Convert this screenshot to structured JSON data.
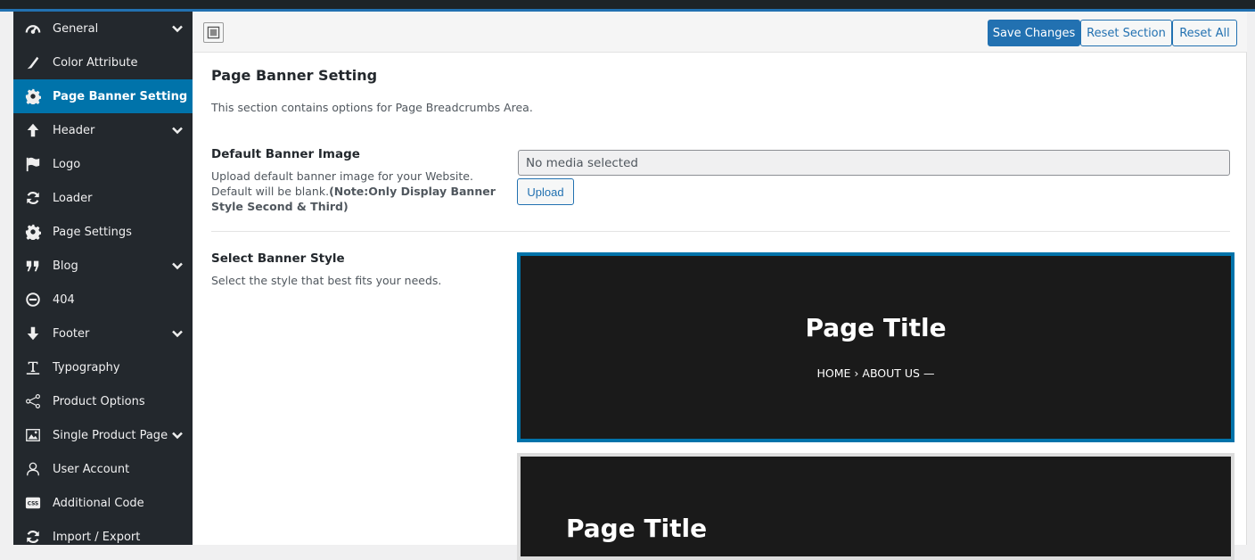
{
  "sidebar": {
    "items": [
      {
        "label": "General",
        "icon": "dashboard-icon",
        "expandable": true
      },
      {
        "label": "Color Attribute",
        "icon": "brush-icon",
        "expandable": false
      },
      {
        "label": "Page Banner Setting",
        "icon": "gear-icon",
        "expandable": false,
        "active": true
      },
      {
        "label": "Header",
        "icon": "arrow-up-icon",
        "expandable": true
      },
      {
        "label": "Logo",
        "icon": "flag-icon",
        "expandable": false
      },
      {
        "label": "Loader",
        "icon": "refresh-icon",
        "expandable": false
      },
      {
        "label": "Page Settings",
        "icon": "gear-icon",
        "expandable": false
      },
      {
        "label": "Blog",
        "icon": "quote-icon",
        "expandable": true
      },
      {
        "label": "404",
        "icon": "minus-circle-icon",
        "expandable": false
      },
      {
        "label": "Footer",
        "icon": "arrow-down-icon",
        "expandable": true
      },
      {
        "label": "Typography",
        "icon": "text-icon",
        "expandable": false
      },
      {
        "label": "Product Options",
        "icon": "share-icon",
        "expandable": false
      },
      {
        "label": "Single Product Page",
        "icon": "image-icon",
        "expandable": true
      },
      {
        "label": "User Account",
        "icon": "user-icon",
        "expandable": false
      },
      {
        "label": "Additional Code",
        "icon": "css-icon",
        "expandable": false
      },
      {
        "label": "Import / Export",
        "icon": "refresh-icon",
        "expandable": false
      }
    ]
  },
  "toolbar": {
    "save_label": "Save Changes",
    "reset_section_label": "Reset Section",
    "reset_all_label": "Reset All"
  },
  "section": {
    "title": "Page Banner Setting",
    "description": "This section contains options for Page Breadcrumbs Area."
  },
  "banner_image": {
    "title": "Default Banner Image",
    "description": "Upload default banner image for your Website. Default will be blank.",
    "note": "(Note:Only Display Banner Style Second & Third)",
    "value": "No media selected",
    "upload_label": "Upload"
  },
  "banner_style": {
    "title": "Select Banner Style",
    "description": "Select the style that best fits your needs.",
    "options": [
      {
        "page_title": "Page Title",
        "breadcrumb": "HOME  ›  ABOUT US —",
        "selected": true
      },
      {
        "page_title": "Page Title",
        "selected": false
      }
    ]
  },
  "colors": {
    "accent": "#0073aa",
    "sidebar_bg": "#23282d",
    "preview_bg": "#1a1a1a"
  }
}
